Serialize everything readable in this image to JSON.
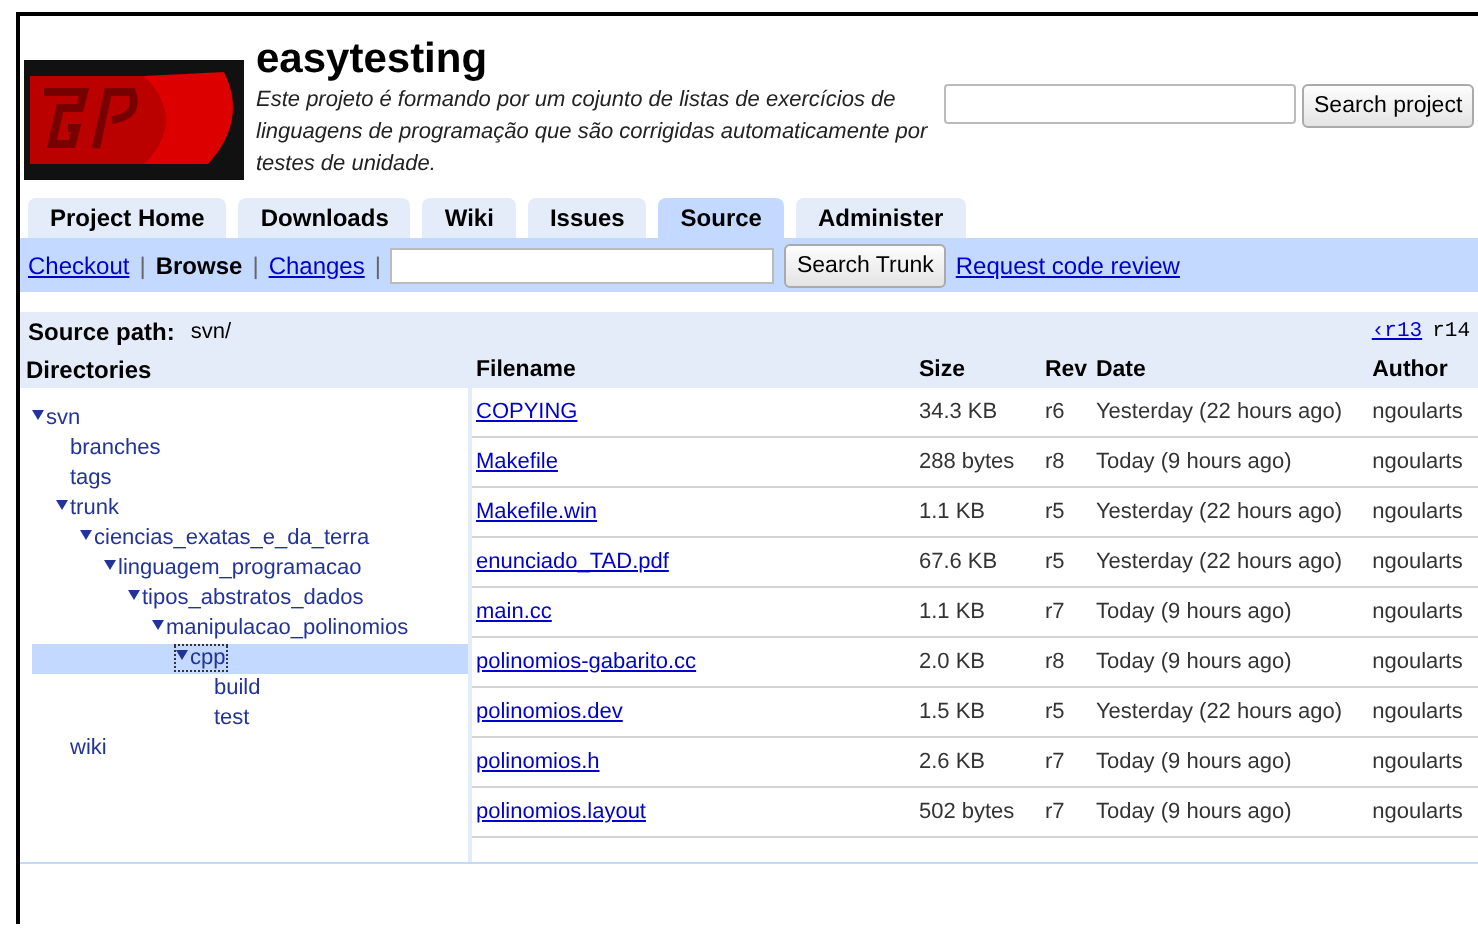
{
  "project": {
    "name": "easytesting",
    "description": "Este projeto é formando por um cojunto de listas de exercícios de linguagens de programação que são corrigidas automaticamente por testes de unidade."
  },
  "search": {
    "button": "Search project"
  },
  "tabs": [
    {
      "label": "Project Home",
      "selected": false
    },
    {
      "label": "Downloads",
      "selected": false
    },
    {
      "label": "Wiki",
      "selected": false
    },
    {
      "label": "Issues",
      "selected": false
    },
    {
      "label": "Source",
      "selected": true
    },
    {
      "label": "Administer",
      "selected": false
    }
  ],
  "subnav": {
    "separator": "|",
    "links": [
      {
        "label": "Checkout",
        "selected": false
      },
      {
        "label": "Browse",
        "selected": true
      },
      {
        "label": "Changes",
        "selected": false
      }
    ],
    "search_button": "Search Trunk",
    "review_link": "Request code review"
  },
  "source_path": {
    "label": "Source path:",
    "value": "svn/",
    "revisions": [
      "‹r13",
      "r14"
    ]
  },
  "directories": {
    "title": "Directories",
    "tree": [
      {
        "name": "svn",
        "expanded": true,
        "selected": false,
        "children": [
          {
            "name": "branches",
            "expanded": false,
            "selected": false
          },
          {
            "name": "tags",
            "expanded": false,
            "selected": false
          },
          {
            "name": "trunk",
            "expanded": true,
            "selected": false,
            "children": [
              {
                "name": "ciencias_exatas_e_da_terra",
                "expanded": true,
                "selected": false,
                "children": [
                  {
                    "name": "linguagem_programacao",
                    "expanded": true,
                    "selected": false,
                    "children": [
                      {
                        "name": "tipos_abstratos_dados",
                        "expanded": true,
                        "selected": false,
                        "children": [
                          {
                            "name": "manipulacao_polinomios",
                            "expanded": true,
                            "selected": false,
                            "children": [
                              {
                                "name": "cpp",
                                "expanded": true,
                                "selected": true,
                                "children": [
                                  {
                                    "name": "build",
                                    "expanded": false,
                                    "selected": false
                                  },
                                  {
                                    "name": "test",
                                    "expanded": false,
                                    "selected": false
                                  }
                                ]
                              }
                            ]
                          }
                        ]
                      }
                    ]
                  }
                ]
              }
            ]
          },
          {
            "name": "wiki",
            "expanded": false,
            "selected": false
          }
        ]
      }
    ]
  },
  "files": {
    "columns": [
      "Filename",
      "Size",
      "Rev",
      "Date",
      "Author"
    ],
    "rows": [
      [
        "COPYING",
        "34.3 KB",
        "r6",
        "Yesterday (22 hours ago)",
        "ngoularts"
      ],
      [
        "Makefile",
        "288 bytes",
        "r8",
        "Today (9 hours ago)",
        "ngoularts"
      ],
      [
        "Makefile.win",
        "1.1 KB",
        "r5",
        "Yesterday (22 hours ago)",
        "ngoularts"
      ],
      [
        "enunciado_TAD.pdf",
        "67.6 KB",
        "r5",
        "Yesterday (22 hours ago)",
        "ngoularts"
      ],
      [
        "main.cc",
        "1.1 KB",
        "r7",
        "Today (9 hours ago)",
        "ngoularts"
      ],
      [
        "polinomios-gabarito.cc",
        "2.0 KB",
        "r8",
        "Today (9 hours ago)",
        "ngoularts"
      ],
      [
        "polinomios.dev",
        "1.5 KB",
        "r5",
        "Yesterday (22 hours ago)",
        "ngoularts"
      ],
      [
        "polinomios.h",
        "2.6 KB",
        "r7",
        "Today (9 hours ago)",
        "ngoularts"
      ],
      [
        "polinomios.layout",
        "502 bytes",
        "r7",
        "Today (9 hours ago)",
        "ngoularts"
      ]
    ]
  }
}
